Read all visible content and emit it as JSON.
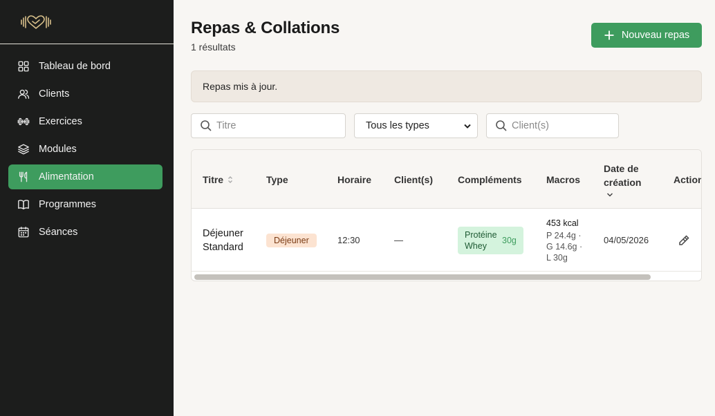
{
  "sidebar": {
    "items": [
      {
        "label": "Tableau de bord",
        "icon": "grid-icon",
        "active": false
      },
      {
        "label": "Clients",
        "icon": "users-icon",
        "active": false
      },
      {
        "label": "Exercices",
        "icon": "dumbbell-icon",
        "active": false
      },
      {
        "label": "Modules",
        "icon": "layers-icon",
        "active": false
      },
      {
        "label": "Alimentation",
        "icon": "utensils-icon",
        "active": true
      },
      {
        "label": "Programmes",
        "icon": "book-icon",
        "active": false
      },
      {
        "label": "Séances",
        "icon": "calendar-icon",
        "active": false
      }
    ]
  },
  "header": {
    "title": "Repas & Collations",
    "count": "1 résultats",
    "new_button": "Nouveau repas"
  },
  "alert": {
    "message": "Repas mis à jour."
  },
  "filters": {
    "title_placeholder": "Titre",
    "type_selected": "Tous les types",
    "client_placeholder": "Client(s)"
  },
  "table": {
    "columns": {
      "title": "Titre",
      "type": "Type",
      "time": "Horaire",
      "clients": "Client(s)",
      "supplements": "Compléments",
      "macros": "Macros",
      "date_line1": "Date de",
      "date_line2": "création",
      "actions": "Actions"
    },
    "rows": [
      {
        "title": "Déjeuner Standard",
        "type": "Déjeuner",
        "time": "12:30",
        "clients": "—",
        "supplement_name": "Protéine Whey",
        "supplement_qty": "30g",
        "kcal": "453 kcal",
        "macros": "P 24.4g · G 14.6g · L 30g",
        "date": "04/05/2026"
      }
    ]
  },
  "colors": {
    "sidebar_bg": "#1c1d1c",
    "accent": "#3e9c5e",
    "page_bg": "#f8f6f3",
    "alert_bg": "#efe9e2",
    "type_badge_bg": "#fce3d1",
    "supplement_badge_bg": "#d4f3dd"
  }
}
